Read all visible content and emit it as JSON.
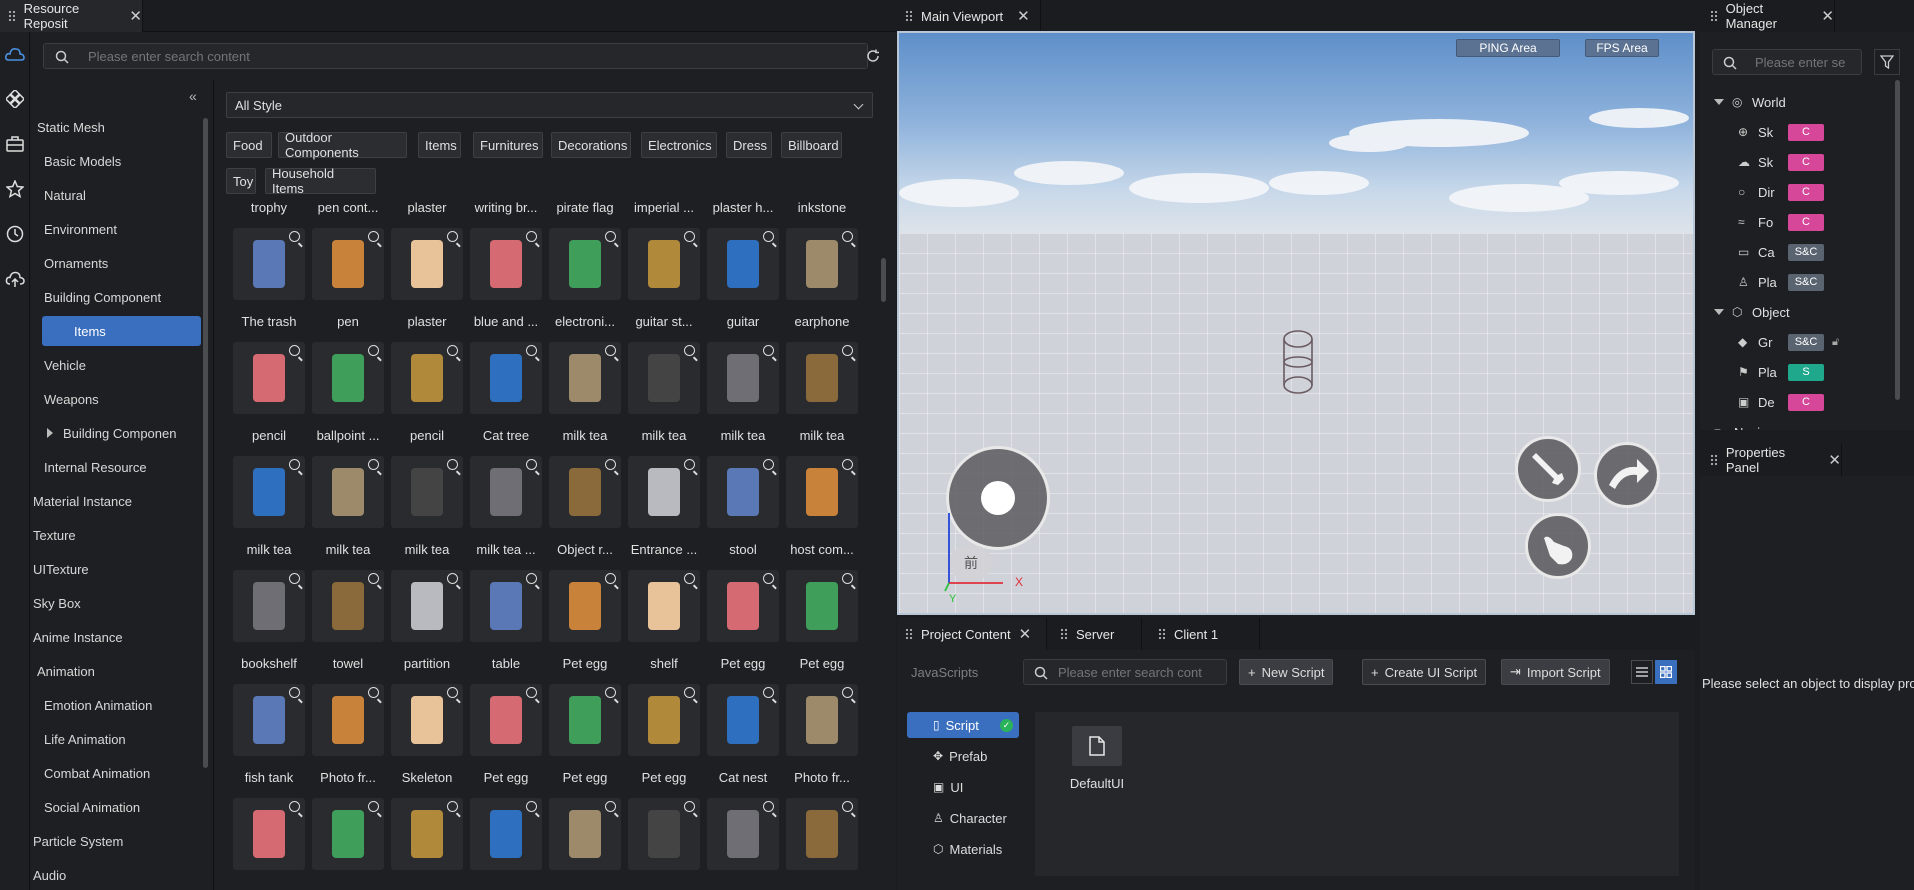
{
  "resource": {
    "tab_title": "Resource Reposit",
    "search_placeholder": "Please enter search content",
    "style_select": "All Style",
    "categories": [
      "Food",
      "Outdoor Components",
      "Items",
      "Furnitures",
      "Decorations",
      "Electronics",
      "Dress",
      "Billboard",
      "Toy",
      "Household Items"
    ],
    "tree": [
      {
        "label": "Static Mesh",
        "level": 0,
        "state": "open"
      },
      {
        "label": "Basic Models",
        "level": 1
      },
      {
        "label": "Natural",
        "level": 1
      },
      {
        "label": "Environment",
        "level": 1
      },
      {
        "label": "Ornaments",
        "level": 1
      },
      {
        "label": "Building Component",
        "level": 1
      },
      {
        "label": "Items",
        "level": 1,
        "selected": true
      },
      {
        "label": "Vehicle",
        "level": 1
      },
      {
        "label": "Weapons",
        "level": 1
      },
      {
        "label": "Building Componen",
        "level": 1,
        "state": "closed"
      },
      {
        "label": "Internal Resource",
        "level": 1
      },
      {
        "label": "Material Instance",
        "level": 0,
        "state": "closed"
      },
      {
        "label": "Texture",
        "level": 0,
        "state": "closed"
      },
      {
        "label": "UITexture",
        "level": 0,
        "state": "closed"
      },
      {
        "label": "Sky Box",
        "level": 0,
        "state": "closed"
      },
      {
        "label": "Anime Instance",
        "level": 0,
        "state": "closed"
      },
      {
        "label": "Animation",
        "level": 0,
        "state": "open"
      },
      {
        "label": "Emotion Animation",
        "level": 1
      },
      {
        "label": "Life Animation",
        "level": 1
      },
      {
        "label": "Combat Animation",
        "level": 1
      },
      {
        "label": "Social Animation",
        "level": 1
      },
      {
        "label": "Particle System",
        "level": 0,
        "state": "closed"
      },
      {
        "label": "Audio",
        "level": 0,
        "state": "closed"
      }
    ],
    "assets": [
      [
        "trophy",
        "pen cont...",
        "plaster",
        "writing br...",
        "pirate flag",
        "imperial ...",
        "plaster h...",
        "inkstone"
      ],
      [
        "The trash",
        "pen",
        "plaster",
        "blue and ...",
        "electroni...",
        "guitar st...",
        "guitar",
        "earphone"
      ],
      [
        "pencil",
        "ballpoint ...",
        "pencil",
        "Cat tree",
        "milk tea",
        "milk tea",
        "milk tea",
        "milk tea"
      ],
      [
        "milk tea",
        "milk tea",
        "milk tea",
        "milk tea ...",
        "Object r...",
        "Entrance ...",
        "stool",
        "host com..."
      ],
      [
        "bookshelf",
        "towel",
        "partition",
        "table",
        "Pet egg",
        "shelf",
        "Pet egg",
        "Pet egg"
      ],
      [
        "fish tank",
        "Photo fr...",
        "Skeleton",
        "Pet egg",
        "Pet egg",
        "Pet egg",
        "Cat nest",
        "Photo fr..."
      ],
      [
        "",
        "",
        "",
        "",
        "",
        "",
        "",
        ""
      ]
    ]
  },
  "viewport": {
    "tab_title": "Main Viewport",
    "ping": "PING Area",
    "fps": "FPS Area",
    "joystick_char": "前",
    "axis_x": "X",
    "axis_y": "Y"
  },
  "object_manager": {
    "tab_title": "Object Manager",
    "search_placeholder": "Please enter se",
    "items": [
      {
        "label": "World",
        "level": 0,
        "icon": "world-icon"
      },
      {
        "label": "Sk",
        "level": 1,
        "icon": "globe-icon",
        "badge": "C"
      },
      {
        "label": "Sk",
        "level": 1,
        "icon": "cloud-icon",
        "badge": "C"
      },
      {
        "label": "Dir",
        "level": 1,
        "icon": "light-icon",
        "badge": "C"
      },
      {
        "label": "Fo",
        "level": 1,
        "icon": "fog-icon",
        "badge": "C"
      },
      {
        "label": "Ca",
        "level": 1,
        "icon": "camera-icon",
        "badge": "S&C"
      },
      {
        "label": "Pla",
        "level": 1,
        "icon": "player-icon",
        "badge": "S&C"
      },
      {
        "label": "Object",
        "level": 0,
        "icon": "object-icon"
      },
      {
        "label": "Gr",
        "level": 1,
        "icon": "ground-icon",
        "badge": "S&C",
        "lock": true
      },
      {
        "label": "Pla",
        "level": 1,
        "icon": "flag-icon",
        "badge": "S"
      },
      {
        "label": "De",
        "level": 1,
        "icon": "device-icon",
        "badge": "C"
      },
      {
        "label": "Navig",
        "level": 0,
        "icon": "nav-icon"
      }
    ]
  },
  "properties": {
    "tab_title": "Properties Panel",
    "empty_text": "Please select an object to display prope"
  },
  "bottom": {
    "tabs": [
      "Project Content",
      "Server",
      "Client 1"
    ],
    "section": "JavaScripts",
    "search_placeholder": "Please enter search cont",
    "new_script": "New Script",
    "create_ui_script": "Create UI Script",
    "import_script": "Import Script",
    "nav": [
      "Script",
      "Prefab",
      "UI",
      "Character",
      "Materials"
    ],
    "file_name": "DefaultUI"
  },
  "colors": {
    "accent": "#3a6fbf",
    "badge_c": "#d6479a",
    "badge_sc": "#5a6470",
    "badge_s": "#1fa88c"
  }
}
